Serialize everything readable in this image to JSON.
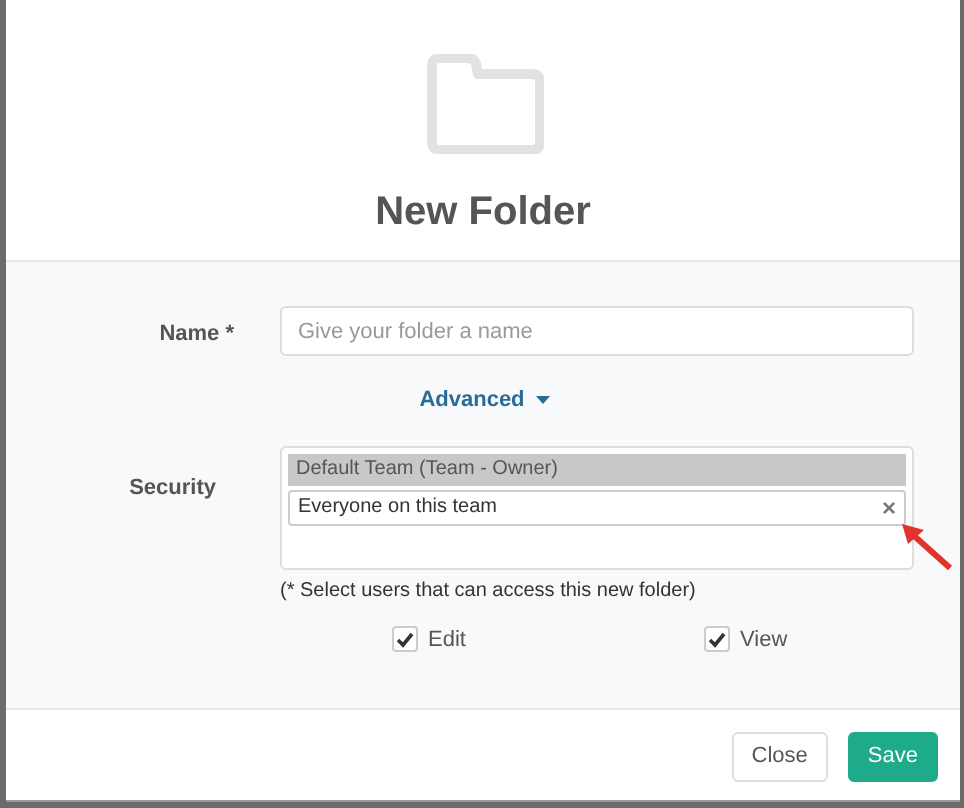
{
  "dialog": {
    "title": "New Folder"
  },
  "name_field": {
    "label": "Name *",
    "placeholder": "Give your folder a name"
  },
  "advanced": {
    "label": "Advanced",
    "expanded": true
  },
  "security": {
    "label": "Security",
    "group": "Default Team (Team - Owner)",
    "members": [
      "Everyone on this team"
    ],
    "remove_mark": "×",
    "hint": "(* Select users that can access this new folder)"
  },
  "permissions": [
    {
      "label": "Edit",
      "checked": true
    },
    {
      "label": "View",
      "checked": true
    }
  ],
  "buttons": [
    {
      "label": "Close",
      "kind": "secondary"
    },
    {
      "label": "Save",
      "kind": "primary"
    }
  ]
}
